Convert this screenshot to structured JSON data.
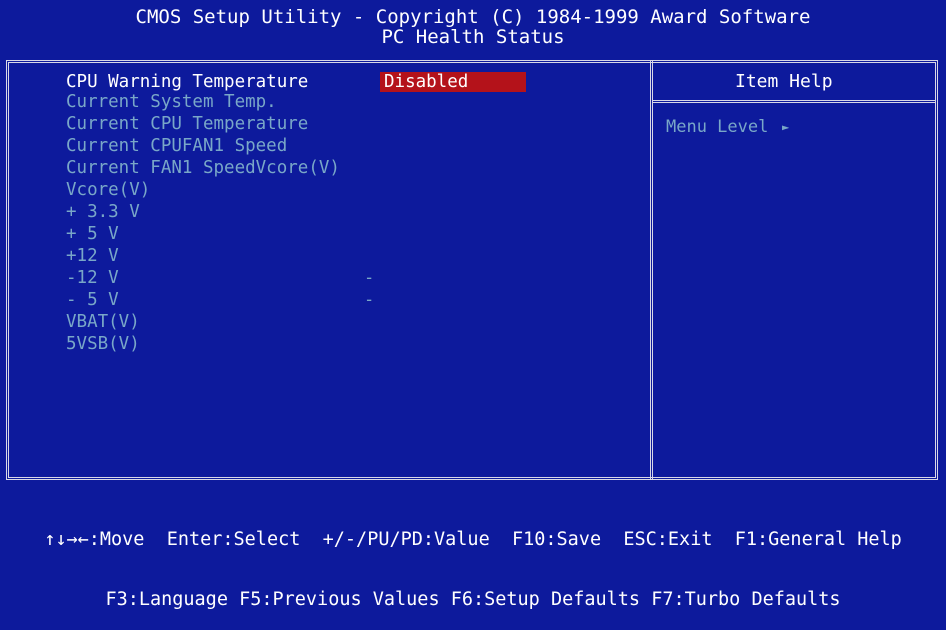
{
  "header": {
    "title": "CMOS Setup Utility - Copyright (C) 1984-1999 Award Software",
    "subtitle": "PC Health Status"
  },
  "menu": {
    "items": [
      {
        "label": "CPU Warning Temperature",
        "value": "Disabled"
      },
      {
        "label": "Current System Temp."
      },
      {
        "label": "Current CPU Temperature"
      },
      {
        "label": "Current CPUFAN1 Speed"
      },
      {
        "label": "Current FAN1 SpeedVcore(V)"
      },
      {
        "label": "Vcore(V)"
      },
      {
        "label": "+ 3.3 V"
      },
      {
        "label": "+ 5 V"
      },
      {
        "label": "+12 V"
      },
      {
        "label": "-12 V",
        "value": "-"
      },
      {
        "label": "- 5 V",
        "value": "-"
      },
      {
        "label": "VBAT(V)"
      },
      {
        "label": "5VSB(V)"
      }
    ]
  },
  "help": {
    "title": "Item Help",
    "menu_level": "Menu Level",
    "arrow": "►"
  },
  "footer": {
    "line1": "↑↓→←:Move  Enter:Select  +/-/PU/PD:Value  F10:Save  ESC:Exit  F1:General Help",
    "line2": "F3:Language F5:Previous Values F6:Setup Defaults F7:Turbo Defaults"
  },
  "colors": {
    "background": "#0d1a9c",
    "highlight": "#b4121a",
    "inactive_text": "#79a7c8",
    "active_text": "#ffffff"
  }
}
